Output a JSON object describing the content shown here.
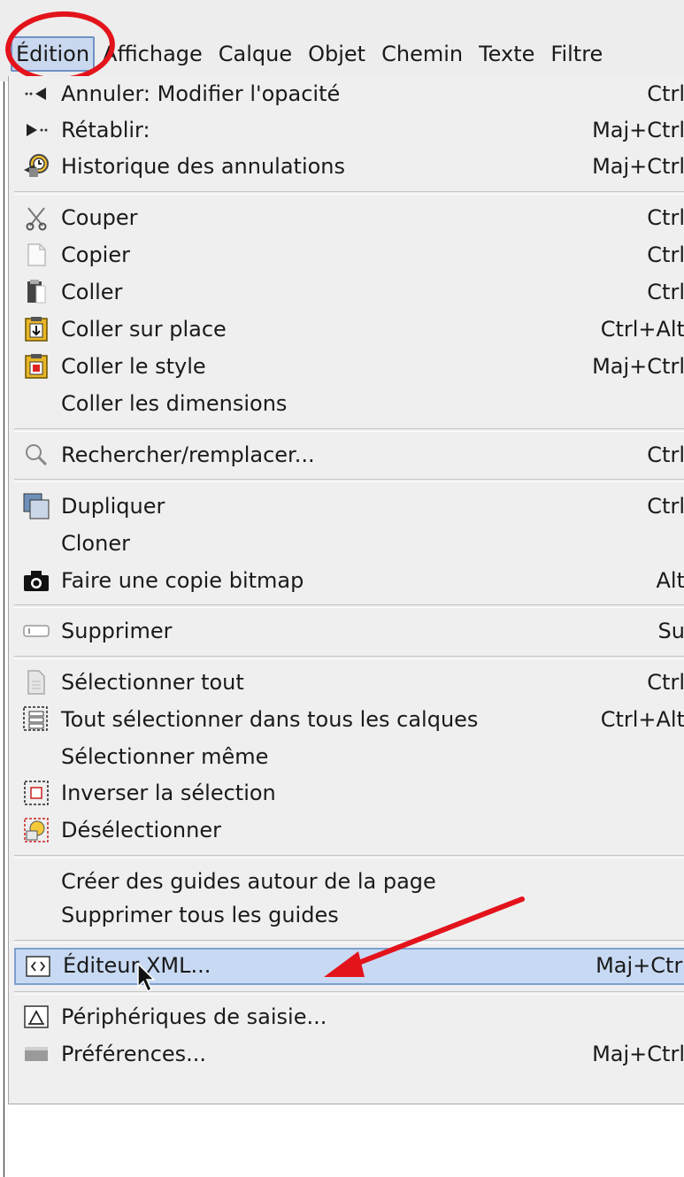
{
  "menubar": {
    "items": [
      "Édition",
      "Affichage",
      "Calque",
      "Objet",
      "Chemin",
      "Texte",
      "Filtre"
    ]
  },
  "menu": {
    "items": [
      {
        "icon": "undo-icon",
        "label": "Annuler: Modifier l'opacité",
        "accel": "Ctrl"
      },
      {
        "icon": "redo-icon",
        "label": "Rétablir:",
        "accel": "Maj+Ctrl"
      },
      {
        "icon": "history-icon",
        "label": "Historique des annulations",
        "accel": "Maj+Ctrl"
      },
      {
        "icon": "scissors-icon",
        "label": "Couper",
        "accel": "Ctrl"
      },
      {
        "icon": "copy-icon",
        "label": "Copier",
        "accel": "Ctrl"
      },
      {
        "icon": "paste-icon",
        "label": "Coller",
        "accel": "Ctrl"
      },
      {
        "icon": "paste-in-place-icon",
        "label": "Coller sur place",
        "accel": "Ctrl+Alt"
      },
      {
        "icon": "paste-style-icon",
        "label": "Coller le style",
        "accel": "Maj+Ctrl"
      },
      {
        "icon": "",
        "label": "Coller les dimensions",
        "accel": ""
      },
      {
        "icon": "search-icon",
        "label": "Rechercher/remplacer...",
        "accel": "Ctrl"
      },
      {
        "icon": "duplicate-icon",
        "label": "Dupliquer",
        "accel": "Ctrl"
      },
      {
        "icon": "",
        "label": "Cloner",
        "accel": ""
      },
      {
        "icon": "camera-icon",
        "label": "Faire une copie bitmap",
        "accel": "Alt"
      },
      {
        "icon": "delete-icon",
        "label": "Supprimer",
        "accel": "Su"
      },
      {
        "icon": "document-icon",
        "label": "Sélectionner tout",
        "accel": "Ctrl"
      },
      {
        "icon": "select-all-layers-icon",
        "label": "Tout sélectionner dans tous les calques",
        "accel": "Ctrl+Alt"
      },
      {
        "icon": "",
        "label": "Sélectionner même",
        "accel": ""
      },
      {
        "icon": "invert-selection-icon",
        "label": "Inverser la sélection",
        "accel": ""
      },
      {
        "icon": "deselect-icon",
        "label": "Désélectionner",
        "accel": ""
      },
      {
        "icon": "",
        "label": "Créer des guides autour de la page",
        "accel": ""
      },
      {
        "icon": "",
        "label": "Supprimer tous les guides",
        "accel": ""
      },
      {
        "icon": "xml-editor-icon",
        "label": "Éditeur XML...",
        "accel": "Maj+Ctrl"
      },
      {
        "icon": "input-devices-icon",
        "label": "Périphériques de saisie...",
        "accel": ""
      },
      {
        "icon": "preferences-icon",
        "label": "Préférences...",
        "accel": "Maj+Ctrl"
      }
    ],
    "highlighted_label": "Éditeur XML..."
  },
  "annotation": {
    "circle_color": "#e3131b",
    "arrow_color": "#e3131b"
  },
  "colors": {
    "highlight_bg": "#c8daf3",
    "highlight_border": "#7da0cf",
    "menu_bg": "#efefef"
  }
}
